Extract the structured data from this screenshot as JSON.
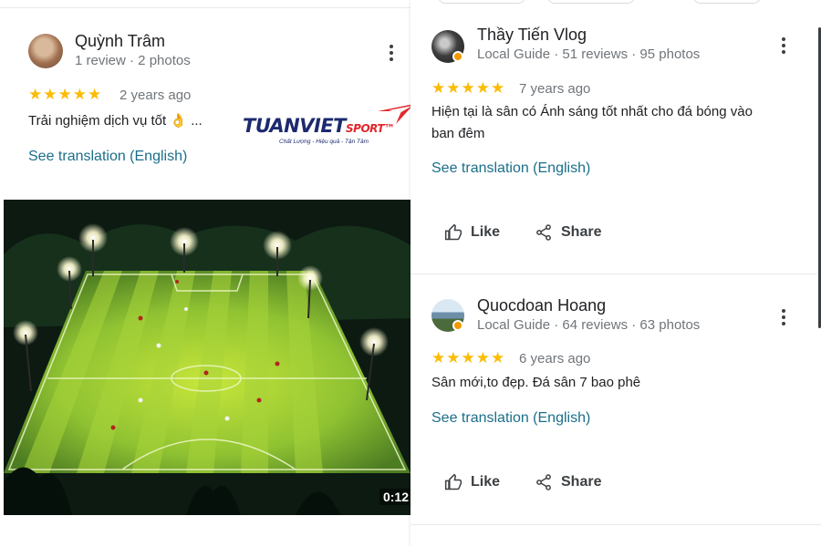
{
  "left_review": {
    "reviewer_name": "Quỳnh Trâm",
    "reviewer_meta": "1 review · 2 photos",
    "stars": "★★★★★",
    "rating": 5,
    "time_ago": "2 years ago",
    "text": "Trải nghiệm dịch vụ tốt 👌 ...",
    "translate_label": "See translation (English)",
    "more_icon": "more-vert-icon",
    "media": {
      "duration": "0:12"
    }
  },
  "logo": {
    "brand": "TUANVIET",
    "brand_sub": "SPORT",
    "trademark": "™",
    "tagline": "Chất Lượng - Hiệu quả - Tận Tâm"
  },
  "right_reviews": [
    {
      "reviewer_name": "Thầy Tiến Vlog",
      "reviewer_meta": "Local Guide · 51 reviews · 95 photos",
      "stars": "★★★★★",
      "rating": 5,
      "time_ago": "7 years ago",
      "text_line1": "Hiện tại là sân có Ánh sáng tốt nhất cho đá bóng vào",
      "text_line2": "ban đêm",
      "translate_label": "See translation (English)",
      "like_label": "Like",
      "share_label": "Share"
    },
    {
      "reviewer_name": "Quocdoan Hoang",
      "reviewer_meta": "Local Guide · 64 reviews · 63 photos",
      "stars": "★★★★★",
      "rating": 5,
      "time_ago": "6 years ago",
      "text_line1": "Sân mới,to đẹp. Đá sân 7 bao phê",
      "translate_label": "See translation (English)",
      "like_label": "Like",
      "share_label": "Share"
    }
  ],
  "colors": {
    "star": "#fbbc04",
    "link": "#1b6f8a",
    "secondary_text": "#70757a",
    "brand_navy": "#1c2a6e",
    "brand_red": "#e3262e"
  }
}
